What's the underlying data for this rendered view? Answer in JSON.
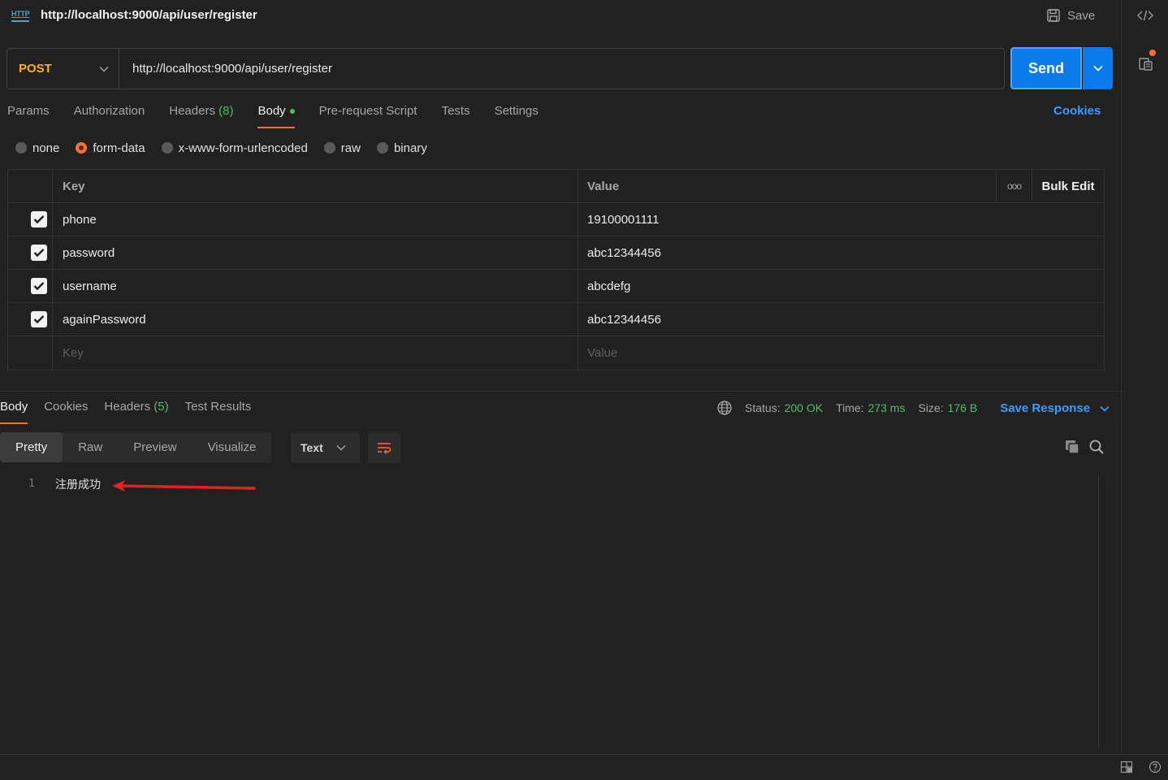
{
  "titlebar": {
    "http_badge": "HTTP",
    "title": "http://localhost:9000/api/user/register",
    "save_label": "Save"
  },
  "request": {
    "method": "POST",
    "url": "http://localhost:9000/api/user/register",
    "send_label": "Send"
  },
  "req_tabs": {
    "params": "Params",
    "authorization": "Authorization",
    "headers": "Headers",
    "headers_count": "(8)",
    "body": "Body",
    "prerequest": "Pre-request Script",
    "tests": "Tests",
    "settings": "Settings",
    "cookies": "Cookies"
  },
  "body_types": {
    "none": "none",
    "form_data": "form-data",
    "urlencoded": "x-www-form-urlencoded",
    "raw": "raw",
    "binary": "binary",
    "selected": "form-data"
  },
  "form_table": {
    "key_header": "Key",
    "value_header": "Value",
    "more": "ooo",
    "bulk_edit": "Bulk Edit",
    "rows": [
      {
        "key": "phone",
        "value": "19100001111",
        "checked": true
      },
      {
        "key": "password",
        "value": "abc12344456",
        "checked": true
      },
      {
        "key": "username",
        "value": "abcdefg",
        "checked": true
      },
      {
        "key": "againPassword",
        "value": "abc12344456",
        "checked": true
      }
    ],
    "key_placeholder": "Key",
    "value_placeholder": "Value"
  },
  "response": {
    "tabs": {
      "body": "Body",
      "cookies": "Cookies",
      "headers": "Headers",
      "headers_count": "(5)",
      "test_results": "Test Results"
    },
    "status_label": "Status:",
    "status_value": "200 OK",
    "time_label": "Time:",
    "time_value": "273 ms",
    "size_label": "Size:",
    "size_value": "176 B",
    "save_response": "Save Response",
    "view_tabs": {
      "pretty": "Pretty",
      "raw": "Raw",
      "preview": "Preview",
      "visualize": "Visualize"
    },
    "format": "Text",
    "line_number": "1",
    "body_text": "注册成功"
  },
  "colors": {
    "accent": "#ff6c37",
    "send": "#097bed",
    "link": "#3b9bff",
    "success": "#4bbf63",
    "method": "#ffb400",
    "annotation_arrow": "#e32222"
  }
}
